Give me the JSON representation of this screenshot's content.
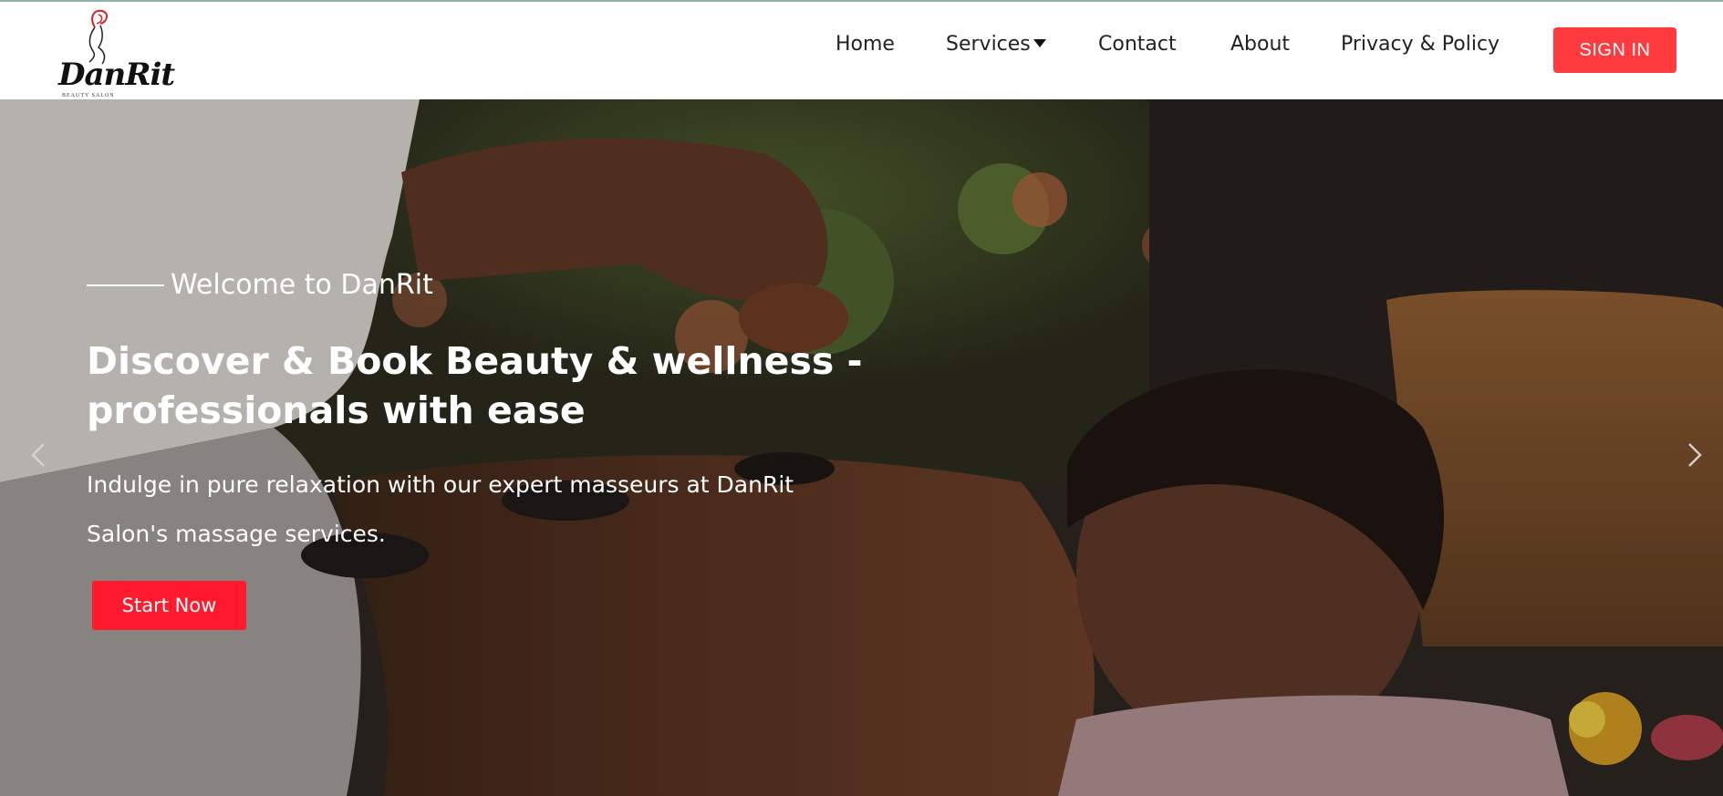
{
  "brand": {
    "name": "DanRit",
    "tagline": "BEAUTY SALON"
  },
  "nav": {
    "items": [
      {
        "label": "Home"
      },
      {
        "label": "Services",
        "has_dropdown": true
      },
      {
        "label": "Contact"
      },
      {
        "label": "About"
      },
      {
        "label": "Privacy & Policy"
      }
    ],
    "signin_label": "SIGN IN"
  },
  "hero": {
    "welcome": "Welcome to DanRit",
    "headline": "Discover & Book Beauty & wellness - professionals with ease",
    "subtext": "Indulge in pure relaxation with our expert masseurs at DanRit Salon's massage services.",
    "cta_label": "Start Now",
    "prev_icon": "chevron-left-icon",
    "next_icon": "chevron-right-icon"
  },
  "colors": {
    "accent": "#ff3b3f",
    "cta": "#ff1b2d",
    "nav_text": "#222222"
  }
}
